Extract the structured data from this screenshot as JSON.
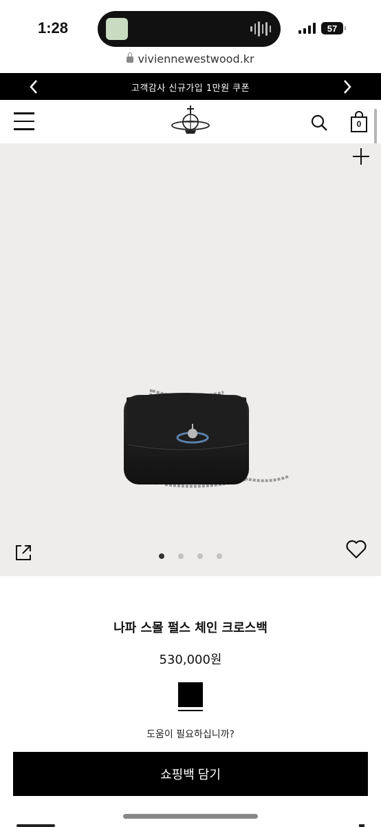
{
  "status_bar": {
    "time": "1:28",
    "battery": "57"
  },
  "browser": {
    "url": "viviennewestwood.kr"
  },
  "promo_banner": {
    "text": "고객감사 신규가입 1만원 쿠폰"
  },
  "header": {
    "logo_icon": "orb-logo-icon",
    "menu_icon": "hamburger-menu-icon",
    "search_icon": "search-icon",
    "bag_icon": "shopping-bag-icon",
    "bag_count": "0"
  },
  "gallery": {
    "background": "#efedeb",
    "total_images": 4,
    "active_index": 0,
    "zoom_icon": "plus-icon",
    "share_icon": "share-icon",
    "wishlist_icon": "heart-icon"
  },
  "product": {
    "name": "나파 스몰 펄스 체인 크로스백",
    "price": "530,000원",
    "selected_color": "#000000"
  },
  "help_text": "도움이 필요하십니까?",
  "add_to_cart_label": "쇼핑백 담기"
}
